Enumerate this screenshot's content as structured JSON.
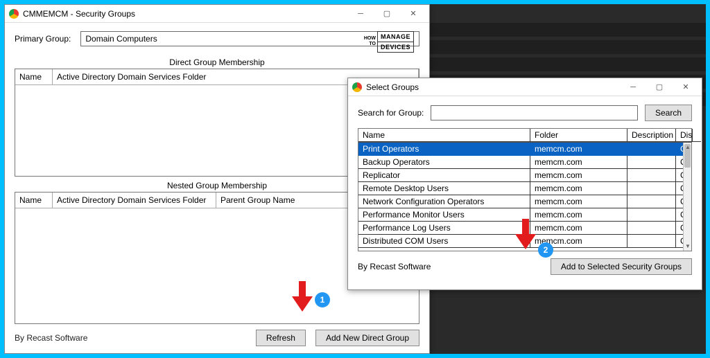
{
  "main_window": {
    "title": "CMMEMCM - Security Groups",
    "primary_group_label": "Primary Group:",
    "primary_group_value": "Domain Computers",
    "direct_section_title": "Direct Group Membership",
    "direct_columns": {
      "name": "Name",
      "folder": "Active Directory Domain Services Folder"
    },
    "nested_section_title": "Nested Group Membership",
    "nested_columns": {
      "name": "Name",
      "folder": "Active Directory Domain Services Folder",
      "parent": "Parent Group Name"
    },
    "refresh_label": "Refresh",
    "add_direct_label": "Add New Direct Group",
    "byline": "By Recast Software"
  },
  "logo": {
    "small1": "HOW",
    "small2": "TO",
    "box1": "MANAGE",
    "box2": "DEVICES"
  },
  "select_window": {
    "title": "Select Groups",
    "search_label": "Search for Group:",
    "search_value": "",
    "search_button": "Search",
    "columns": {
      "name": "Name",
      "folder": "Folder",
      "description": "Description",
      "dis": "Dis"
    },
    "rows": [
      {
        "name": "Print Operators",
        "folder": "memcm.com",
        "desc": "",
        "dis": "CN",
        "selected": true
      },
      {
        "name": "Backup Operators",
        "folder": "memcm.com",
        "desc": "",
        "dis": "CN"
      },
      {
        "name": "Replicator",
        "folder": "memcm.com",
        "desc": "",
        "dis": "CN"
      },
      {
        "name": "Remote Desktop Users",
        "folder": "memcm.com",
        "desc": "",
        "dis": "CN"
      },
      {
        "name": "Network Configuration Operators",
        "folder": "memcm.com",
        "desc": "",
        "dis": "CN"
      },
      {
        "name": "Performance Monitor Users",
        "folder": "memcm.com",
        "desc": "",
        "dis": "CN"
      },
      {
        "name": "Performance Log Users",
        "folder": "memcm.com",
        "desc": "",
        "dis": "CN"
      },
      {
        "name": "Distributed COM Users",
        "folder": "memcm.com",
        "desc": "",
        "dis": "CN"
      }
    ],
    "add_button": "Add to Selected Security Groups",
    "byline": "By Recast Software"
  },
  "annotations": {
    "badge1": "1",
    "badge2": "2"
  }
}
